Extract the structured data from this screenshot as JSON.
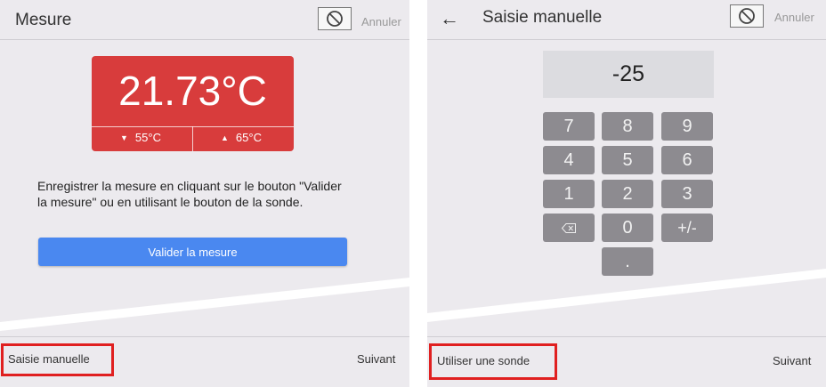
{
  "left": {
    "header": {
      "title": "Mesure",
      "cancel_label": "Annuler"
    },
    "measurement": {
      "value": "21.73°C",
      "low_limit": "55°C",
      "high_limit": "65°C",
      "color": "#d83c3c"
    },
    "instruction": "Enregistrer la mesure en cliquant sur le bouton \"Valider la mesure\" ou en utilisant le bouton de la sonde.",
    "validate_label": "Valider la mesure",
    "footer": {
      "manual_label": "Saisie manuelle",
      "next_label": "Suivant"
    }
  },
  "right": {
    "header": {
      "title": "Saisie manuelle",
      "cancel_label": "Annuler"
    },
    "display_value": "-25",
    "keys": {
      "k7": "7",
      "k8": "8",
      "k9": "9",
      "k4": "4",
      "k5": "5",
      "k6": "6",
      "k1": "1",
      "k2": "2",
      "k3": "3",
      "k0": "0",
      "sign": "+/-",
      "dot": "."
    },
    "footer": {
      "probe_label": "Utiliser une sonde",
      "next_label": "Suivant"
    }
  },
  "icons": {
    "cancel": "prohibited-icon",
    "back": "arrow-left-icon",
    "backspace": "backspace-icon",
    "down": "triangle-down-icon",
    "up": "triangle-up-icon"
  },
  "colors": {
    "accent": "#4a88f0",
    "alert": "#d83c3c",
    "highlight": "#e02020"
  }
}
